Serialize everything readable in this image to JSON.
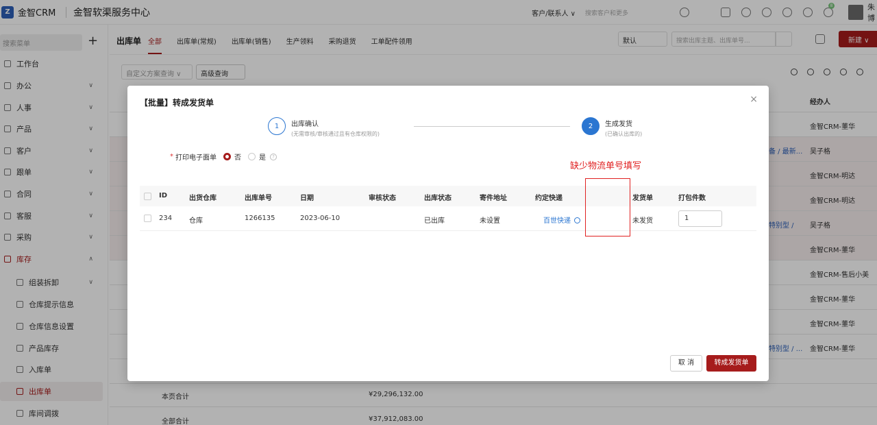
{
  "app": {
    "logo_mark": "Z",
    "logo_text": "金智CRM",
    "center_title": "金智软渠服务中心",
    "customer_select": "客户/联系人 ∨",
    "top_search_placeholder": "搜索客户和更多",
    "user_name": "朱博",
    "badge_count": "8"
  },
  "sidebar": {
    "search_placeholder": "搜索菜单",
    "plus": "+",
    "items": [
      {
        "label": "工作台"
      },
      {
        "label": "办公"
      },
      {
        "label": "人事"
      },
      {
        "label": "产品"
      },
      {
        "label": "客户"
      },
      {
        "label": "跟单"
      },
      {
        "label": "合同"
      },
      {
        "label": "客服"
      },
      {
        "label": "采购"
      },
      {
        "label": "库存"
      }
    ],
    "sub_items": [
      {
        "label": "组装拆卸"
      },
      {
        "label": "仓库提示信息"
      },
      {
        "label": "仓库信息设置"
      },
      {
        "label": "产品库存"
      },
      {
        "label": "入库单"
      },
      {
        "label": "出库单"
      },
      {
        "label": "库间调拨"
      }
    ]
  },
  "header": {
    "page_title": "出库单",
    "tabs": [
      "全部",
      "出库单(常规)",
      "出库单(销售)",
      "生产领料",
      "采购退货",
      "工单配件领用"
    ],
    "sort_value": "默认",
    "search_placeholder": "搜索出库主题、出库单号...",
    "new_button": "新建 ∨"
  },
  "filters": {
    "custom_query": "自定义方案查询 ∨",
    "advanced_query": "高级查询"
  },
  "background_table": {
    "owner_header": "经办人",
    "owners": [
      "金智CRM-董华",
      "吴子格",
      "金智CRM-明达",
      "金智CRM-明达",
      "吴子格",
      "金智CRM-董华",
      "金智CRM-售后小美",
      "金智CRM-董华",
      "金智CRM-董华",
      "金智CRM-董华"
    ],
    "extra_links": [
      "",
      "备 / 最新...",
      "",
      "",
      "特别型 /",
      "",
      "",
      "",
      "",
      "特别型 / ..."
    ],
    "page_total_label": "本页合计",
    "page_total_value": "¥29,296,132.00",
    "all_total_label": "全部合计",
    "all_total_value": "¥37,912,083.00"
  },
  "modal": {
    "title": "【批量】转成发货单",
    "close": "×",
    "step1": {
      "num": "1",
      "name": "出库确认",
      "desc": "(无需审核/审核通过且有仓库权限的)"
    },
    "step2": {
      "num": "2",
      "name": "生成发货",
      "desc": "(已确认出库的)"
    },
    "print_label": "打印电子面单",
    "print_required": "*",
    "option_no": "否",
    "option_yes": "是",
    "help": "?",
    "annotation": "缺少物流单号填写",
    "columns": [
      "ID",
      "出货仓库",
      "出库单号",
      "日期",
      "审核状态",
      "出库状态",
      "寄件地址",
      "约定快递",
      "",
      "发货单",
      "打包件数"
    ],
    "row": {
      "id": "234",
      "warehouse": "仓库",
      "number": "1266135",
      "date": "2023-06-10",
      "audit": "",
      "out_status": "已出库",
      "address": "未设置",
      "courier": "百世快递",
      "tracking": "",
      "ship_status": "未发货",
      "qty": "1"
    },
    "cancel": "取 消",
    "confirm": "转成发货单"
  }
}
